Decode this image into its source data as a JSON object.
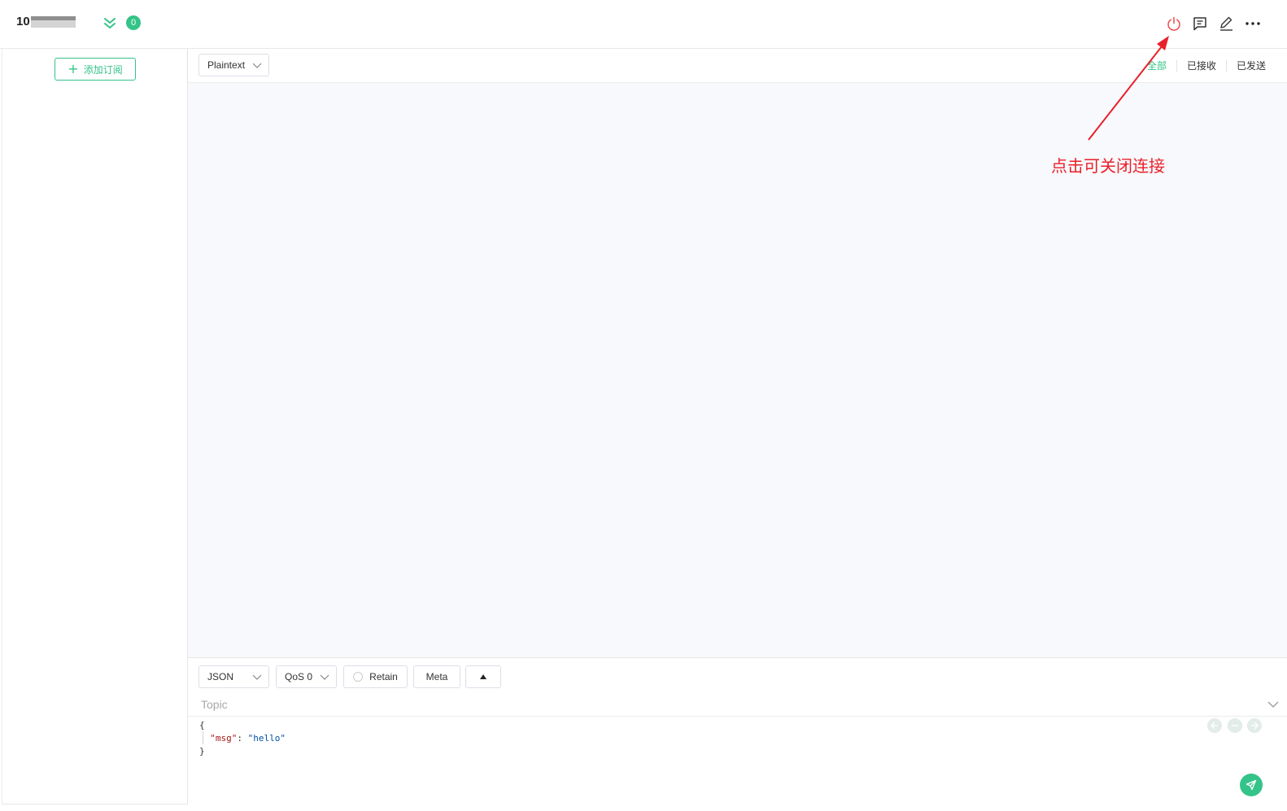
{
  "header": {
    "connection_name": "10",
    "badge_count": "0",
    "icons": [
      "collapse-icon",
      "power-icon",
      "message-icon",
      "edit-icon",
      "more-icon"
    ]
  },
  "sidebar": {
    "add_subscription_label": "添加订阅"
  },
  "toolbar": {
    "payload_format": "Plaintext",
    "filters": [
      "全部",
      "已接收",
      "已发送"
    ],
    "active_filter": "全部"
  },
  "publish": {
    "format": "JSON",
    "qos": "QoS 0",
    "retain_label": "Retain",
    "meta_label": "Meta",
    "topic_placeholder": "Topic",
    "payload": {
      "open": "{",
      "key": "\"msg\"",
      "sep": ": ",
      "value": "\"hello\"",
      "close": "}"
    }
  },
  "annotation": {
    "text": "点击可关闭连接"
  },
  "colors": {
    "accent": "#34c388",
    "power": "#e84c4c",
    "annotation": "#e8202a"
  }
}
